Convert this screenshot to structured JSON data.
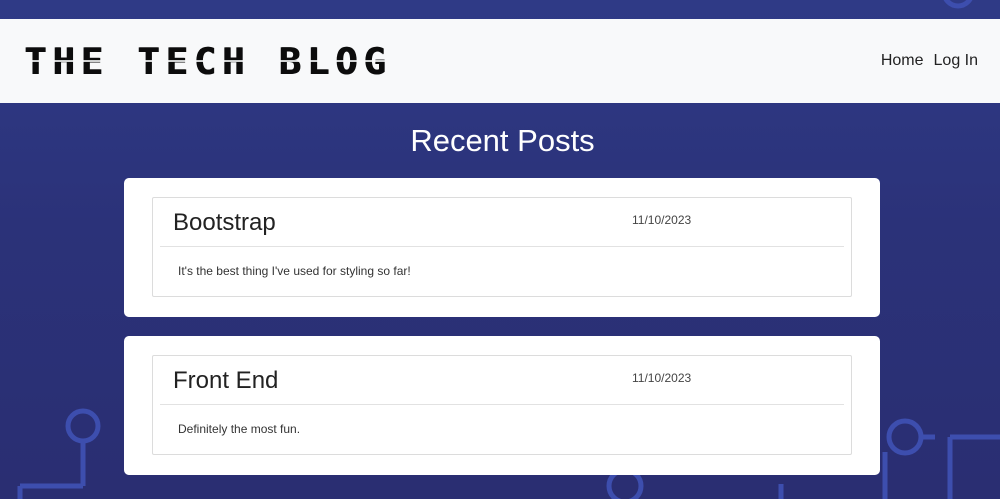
{
  "navbar": {
    "brand": "The Tech Blog",
    "links": [
      {
        "label": "Home"
      },
      {
        "label": "Log In"
      }
    ]
  },
  "main": {
    "heading": "Recent Posts",
    "posts": [
      {
        "title": "Bootstrap",
        "date": "11/10/2023",
        "body": "It's the best thing I've used for styling so far!"
      },
      {
        "title": "Front End",
        "date": "11/10/2023",
        "body": "Definitely the most fun."
      }
    ]
  },
  "colors": {
    "background": "#2b3279",
    "circuit": "#3e4fb0",
    "navbar": "#f8f9fa",
    "card": "#ffffff"
  }
}
